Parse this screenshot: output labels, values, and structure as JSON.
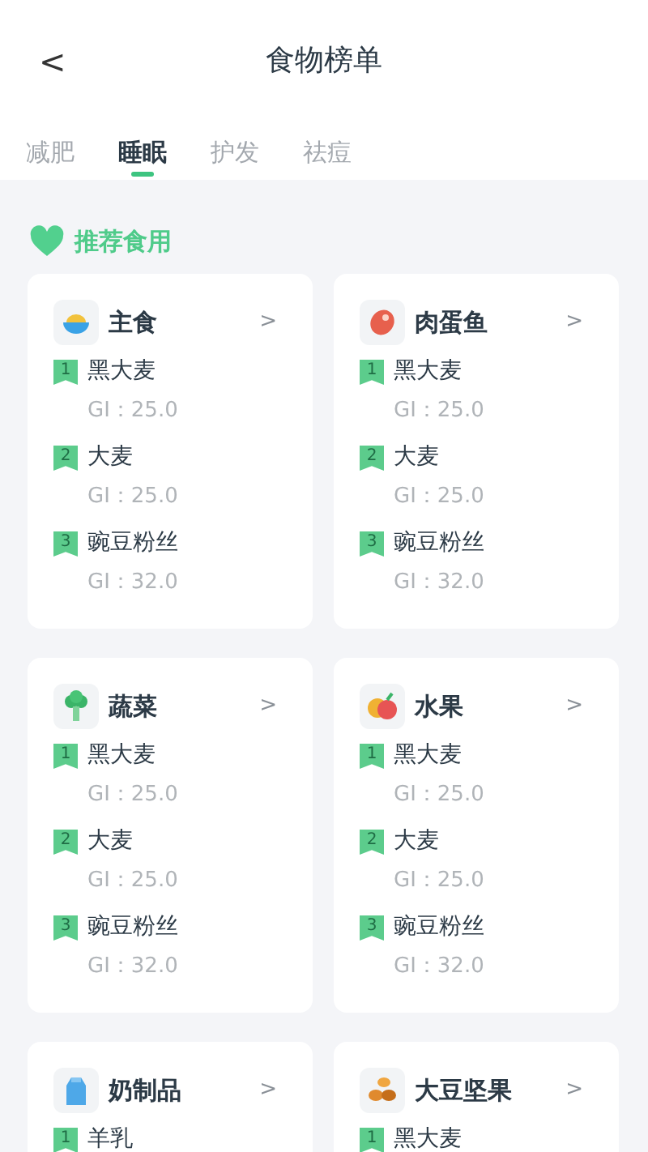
{
  "header": {
    "back": "<",
    "title": "食物榜单"
  },
  "tabs": [
    {
      "label": "减肥",
      "selected": false
    },
    {
      "label": "睡眠",
      "selected": true
    },
    {
      "label": "护发",
      "selected": false
    },
    {
      "label": "祛痘",
      "selected": false
    }
  ],
  "section": {
    "title": "推荐食用"
  },
  "categories": [
    {
      "name": "主食",
      "kind": "bowl",
      "chevron": ">",
      "items": [
        {
          "rank": "1",
          "name": "黑大麦",
          "gi": "GI：25.0"
        },
        {
          "rank": "2",
          "name": "大麦",
          "gi": "GI：25.0"
        },
        {
          "rank": "3",
          "name": "豌豆粉丝",
          "gi": "GI：32.0"
        }
      ]
    },
    {
      "name": "肉蛋鱼",
      "kind": "meat",
      "chevron": ">",
      "items": [
        {
          "rank": "1",
          "name": "黑大麦",
          "gi": "GI：25.0"
        },
        {
          "rank": "2",
          "name": "大麦",
          "gi": "GI：25.0"
        },
        {
          "rank": "3",
          "name": "豌豆粉丝",
          "gi": "GI：32.0"
        }
      ]
    },
    {
      "name": "蔬菜",
      "kind": "vegetable",
      "chevron": ">",
      "items": [
        {
          "rank": "1",
          "name": "黑大麦",
          "gi": "GI：25.0"
        },
        {
          "rank": "2",
          "name": "大麦",
          "gi": "GI：25.0"
        },
        {
          "rank": "3",
          "name": "豌豆粉丝",
          "gi": "GI：32.0"
        }
      ]
    },
    {
      "name": "水果",
      "kind": "fruit",
      "chevron": ">",
      "items": [
        {
          "rank": "1",
          "name": "黑大麦",
          "gi": "GI：25.0"
        },
        {
          "rank": "2",
          "name": "大麦",
          "gi": "GI：25.0"
        },
        {
          "rank": "3",
          "name": "豌豆粉丝",
          "gi": "GI：32.0"
        }
      ]
    },
    {
      "name": "奶制品",
      "kind": "milk",
      "chevron": ">",
      "items": [
        {
          "rank": "1",
          "name": "羊乳"
        }
      ]
    },
    {
      "name": "大豆坚果",
      "kind": "beans",
      "chevron": ">",
      "items": [
        {
          "rank": "1",
          "name": "黑大麦"
        }
      ]
    }
  ]
}
